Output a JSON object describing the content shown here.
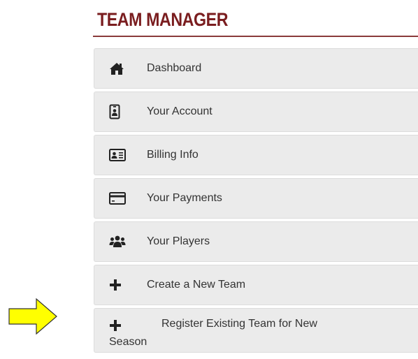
{
  "header": {
    "title": "TEAM MANAGER"
  },
  "menu": {
    "items": [
      {
        "label": "Dashboard",
        "icon": "home-icon"
      },
      {
        "label": "Your Account",
        "icon": "id-badge-icon"
      },
      {
        "label": "Billing Info",
        "icon": "address-card-icon"
      },
      {
        "label": "Your Payments",
        "icon": "credit-card-icon"
      },
      {
        "label": "Your Players",
        "icon": "users-icon"
      },
      {
        "label": "Create a New Team",
        "icon": "plus-icon"
      },
      {
        "label_line1": "Register Existing Team for New",
        "label_line2": "Season",
        "icon": "plus-icon"
      }
    ]
  },
  "annotation": {
    "icon": "arrow-right-icon",
    "color": "#ffff00"
  },
  "colors": {
    "title": "#7a1d1f",
    "item_bg": "#ebebeb",
    "text": "#333333"
  }
}
